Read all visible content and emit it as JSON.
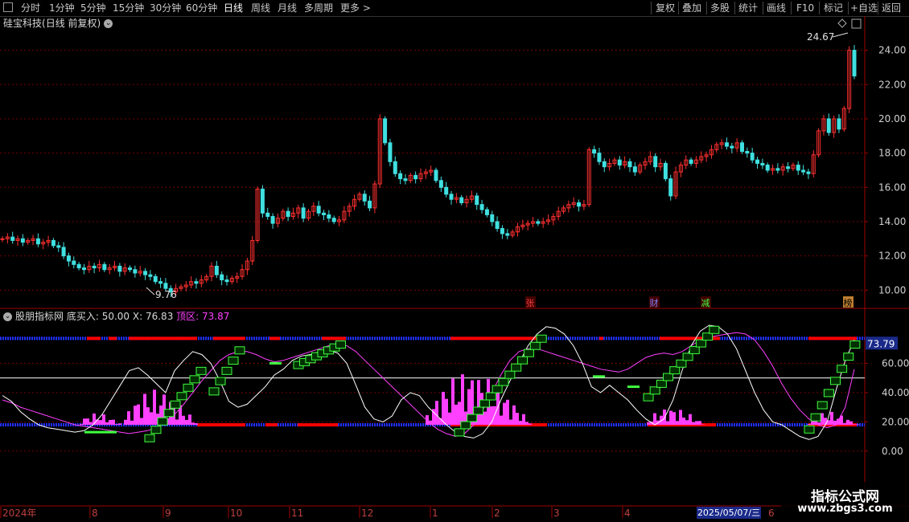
{
  "toolbar": {
    "periods": [
      "分时",
      "1分钟",
      "5分钟",
      "15分钟",
      "30分钟",
      "60分钟",
      "日线",
      "周线",
      "月线",
      "多周期",
      "更多 >"
    ],
    "active": "日线",
    "actions": [
      "复权",
      "叠加",
      "多股",
      "统计",
      "画线",
      "F10",
      "标记",
      "+自选",
      "返回"
    ]
  },
  "stock": {
    "name": "硅宝科技",
    "period_info": "(日线 前复权)"
  },
  "indicator": {
    "name": "股朋指标网",
    "label1": "底买入: 50.00",
    "label2": "X: 76.83",
    "label3": "顶区: 73.87",
    "current_value": "73.79"
  },
  "price_axis": [
    "24.00",
    "22.00",
    "20.00",
    "18.00",
    "16.00",
    "14.00",
    "12.00",
    "10.00"
  ],
  "indicator_axis": [
    "60.00",
    "40.00",
    "20.00",
    "0.00"
  ],
  "annotations": {
    "high": "24.67",
    "low": "9.76"
  },
  "event_markers": [
    "张",
    "财",
    "减",
    "榜"
  ],
  "time_axis": {
    "labels": [
      "2024年",
      "8",
      "9",
      "10",
      "11",
      "12",
      "1",
      "2",
      "3",
      "4"
    ],
    "highlight": "2025/05/07/三",
    "trailing": "6"
  },
  "watermark": {
    "line1": "指标公式网",
    "line2": "www.zbgs3.com"
  },
  "colors": {
    "up": "#ff3030",
    "down": "#40e0e0",
    "grid": "#7a0000",
    "pink": "#ff40ff",
    "green": "#40ff40",
    "blue": "#2030ff",
    "red": "#ff0000"
  },
  "chart_data": {
    "type": "candlestick",
    "ylim": [
      9.5,
      25.2
    ],
    "closes": [
      13.0,
      13.1,
      12.9,
      13.0,
      12.8,
      12.9,
      13.0,
      12.7,
      12.8,
      12.9,
      12.6,
      12.5,
      12.0,
      11.7,
      11.5,
      11.3,
      11.2,
      11.4,
      11.3,
      11.5,
      11.2,
      11.3,
      11.4,
      11.1,
      11.3,
      11.2,
      11.0,
      11.1,
      10.9,
      10.8,
      10.5,
      10.4,
      10.1,
      9.9,
      10.1,
      10.2,
      10.3,
      10.5,
      10.4,
      10.6,
      10.8,
      11.4,
      10.9,
      10.6,
      10.5,
      10.7,
      10.8,
      11.2,
      11.7,
      12.9,
      15.9,
      14.5,
      14.3,
      13.9,
      14.2,
      14.6,
      14.3,
      14.5,
      14.8,
      14.2,
      14.6,
      14.9,
      14.5,
      14.4,
      14.2,
      14.0,
      14.1,
      14.6,
      14.9,
      15.3,
      15.6,
      15.2,
      14.8,
      16.2,
      20.0,
      18.6,
      17.5,
      16.8,
      16.5,
      16.4,
      16.7,
      16.5,
      16.8,
      16.9,
      17.0,
      16.4,
      16.0,
      15.6,
      15.3,
      15.4,
      15.1,
      15.3,
      15.5,
      15.0,
      14.7,
      14.4,
      14.0,
      13.6,
      13.3,
      13.2,
      13.4,
      13.7,
      13.8,
      13.9,
      14.0,
      13.9,
      14.0,
      14.1,
      14.3,
      14.6,
      14.8,
      15.0,
      15.1,
      14.9,
      15.0,
      18.2,
      18.0,
      17.5,
      17.2,
      17.4,
      17.6,
      17.3,
      17.5,
      17.2,
      16.9,
      17.3,
      17.5,
      17.8,
      17.2,
      17.4,
      16.5,
      15.5,
      16.9,
      17.3,
      17.6,
      17.4,
      17.6,
      17.8,
      17.9,
      18.2,
      18.5,
      18.6,
      18.4,
      18.3,
      18.6,
      18.1,
      18.0,
      17.6,
      17.4,
      17.3,
      17.0,
      17.1,
      17.0,
      17.2,
      17.1,
      17.3,
      17.0,
      16.9,
      16.8,
      17.9,
      19.3,
      20.0,
      19.2,
      20.0,
      19.4,
      20.6,
      24.0,
      22.5
    ]
  }
}
